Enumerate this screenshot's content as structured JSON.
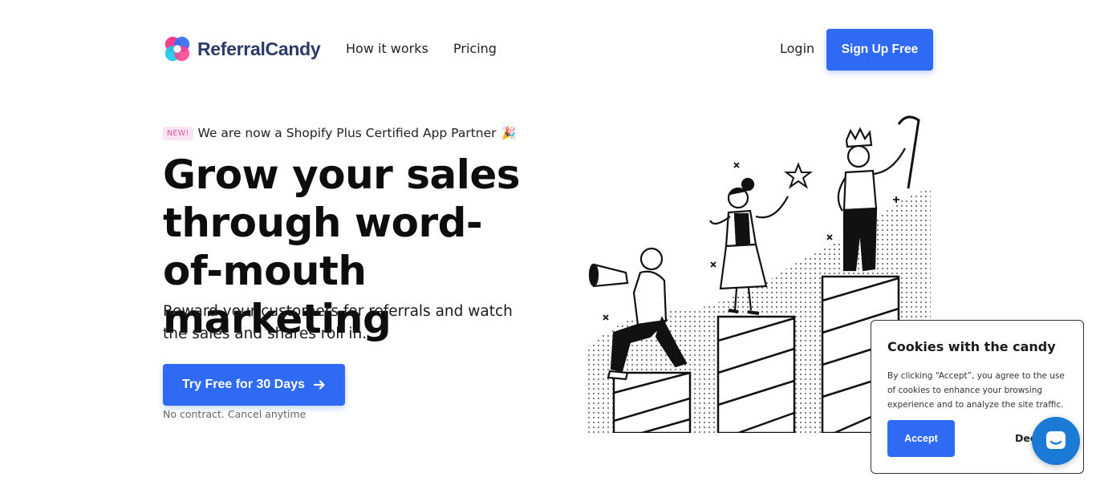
{
  "header": {
    "brand": "ReferralCandy",
    "nav": {
      "how_it_works": "How it works",
      "pricing": "Pricing"
    },
    "login": "Login",
    "signup": "Sign Up Free"
  },
  "hero": {
    "badge": "NEW!",
    "announcement": "We are now a Shopify Plus Certified App Partner",
    "announcement_emoji": "🎉",
    "title": "Grow your sales through word-of-mouth marketing",
    "subtitle": "Reward your customers for referrals and watch the sales and shares roll in.",
    "cta_label": "Try Free for 30 Days",
    "cta_note": "No contract. Cancel anytime"
  },
  "cookie": {
    "title": "Cookies with the candy",
    "text": "By clicking “Accept”, you agree to the use of cookies to enhance your browsing experience and to analyze the site traffic.",
    "accept": "Accept",
    "decline": "Dec"
  },
  "colors": {
    "accent": "#2f6af5",
    "brand_text": "#2b3a67",
    "badge_bg": "#fde4f3",
    "badge_text": "#e0569f",
    "chat": "#1a7ad6"
  },
  "icons": {
    "logo": "referralcandy-logo-icon",
    "cta_arrow": "arrow-right-icon",
    "chat": "chat-bubble-icon"
  }
}
